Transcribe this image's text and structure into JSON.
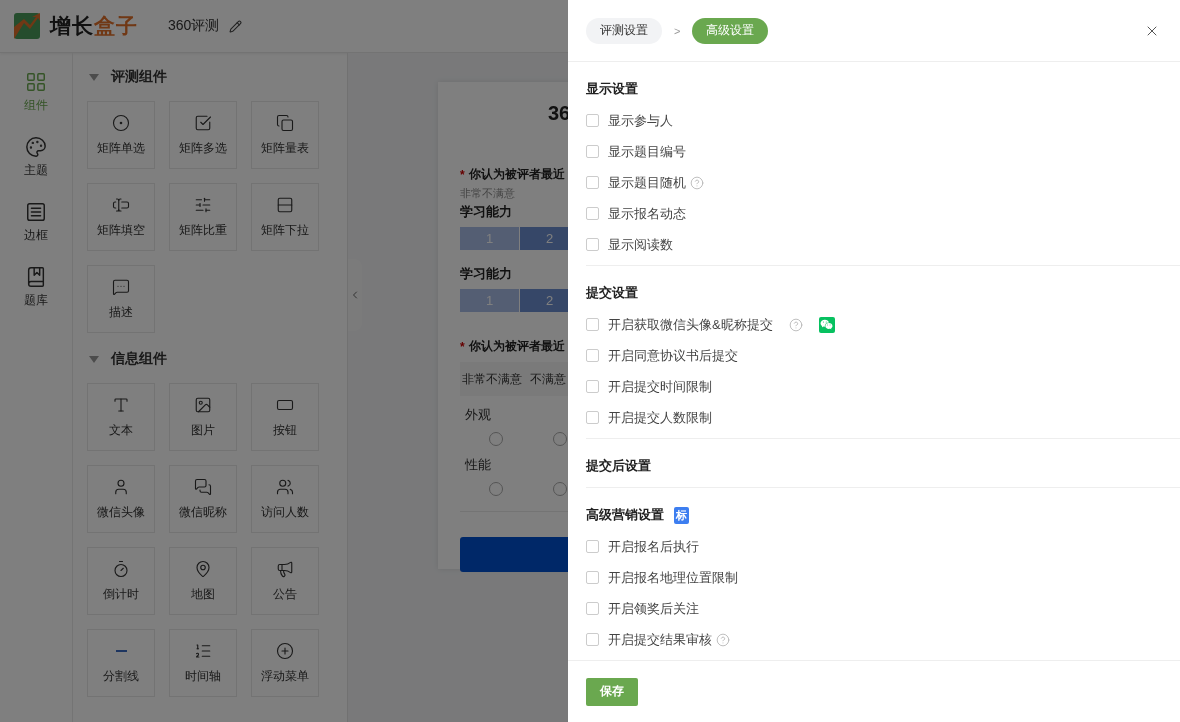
{
  "header": {
    "logo_dark": "增长",
    "logo_accent": "盒子",
    "project_title": "360评测"
  },
  "rail": [
    {
      "label": "组件",
      "selected": true
    },
    {
      "label": "主题",
      "selected": false
    },
    {
      "label": "边框",
      "selected": false
    },
    {
      "label": "题库",
      "selected": false
    }
  ],
  "widget_groups": [
    {
      "title": "评测组件",
      "expanded": true,
      "items": [
        {
          "label": "矩阵单选"
        },
        {
          "label": "矩阵多选"
        },
        {
          "label": "矩阵量表"
        },
        {
          "label": "矩阵填空"
        },
        {
          "label": "矩阵比重"
        },
        {
          "label": "矩阵下拉"
        },
        {
          "label": "描述"
        }
      ]
    },
    {
      "title": "信息组件",
      "expanded": true,
      "items": [
        {
          "label": "文本"
        },
        {
          "label": "图片"
        },
        {
          "label": "按钮"
        },
        {
          "label": "微信头像"
        },
        {
          "label": "微信昵称"
        },
        {
          "label": "访问人数"
        },
        {
          "label": "倒计时"
        },
        {
          "label": "地图"
        },
        {
          "label": "公告"
        },
        {
          "label": "分割线"
        },
        {
          "label": "时间轴"
        },
        {
          "label": "浮动菜单"
        }
      ]
    }
  ],
  "preview": {
    "title": "36",
    "question_1": {
      "required_mark": "*",
      "title": "你认为被评者最近",
      "scale_hint": "非常不满意",
      "rows": [
        {
          "label": "学习能力",
          "cells": [
            "1",
            "2"
          ]
        },
        {
          "label": "学习能力",
          "cells": [
            "1",
            "2"
          ]
        }
      ]
    },
    "question_2": {
      "required_mark": "*",
      "title": "你认为被评者最近",
      "columns": [
        "非常不满意",
        "不满意"
      ],
      "rows": [
        {
          "label": "外观",
          "radios": [
            false,
            false
          ]
        },
        {
          "label": "性能",
          "radios": [
            false,
            false
          ]
        }
      ]
    }
  },
  "drawer": {
    "breadcrumb": [
      {
        "label": "评测设置",
        "selected": false
      },
      {
        "label": "高级设置",
        "selected": true
      }
    ],
    "separator": ">",
    "sections": [
      {
        "title": "显示设置",
        "options": [
          {
            "label": "显示参与人",
            "checked": false
          },
          {
            "label": "显示题目编号",
            "checked": false
          },
          {
            "label": "显示题目随机",
            "checked": false,
            "help": true
          },
          {
            "label": "显示报名动态",
            "checked": false
          },
          {
            "label": "显示阅读数",
            "checked": false
          }
        ]
      },
      {
        "title": "提交设置",
        "options": [
          {
            "label": "开启获取微信头像&昵称提交",
            "checked": false,
            "help": true,
            "wechat": true
          },
          {
            "label": "开启同意协议书后提交",
            "checked": false
          },
          {
            "label": "开启提交时间限制",
            "checked": false
          },
          {
            "label": "开启提交人数限制",
            "checked": false
          }
        ]
      },
      {
        "title": "提交后设置"
      },
      {
        "title": "高级营销设置",
        "badge": "标",
        "options": [
          {
            "label": "开启报名后执行",
            "checked": false
          },
          {
            "label": "开启报名地理位置限制",
            "checked": false
          },
          {
            "label": "开启领奖后关注",
            "checked": false
          },
          {
            "label": "开启提交结果审核",
            "checked": false,
            "help": true
          }
        ]
      }
    ],
    "save": "保存"
  }
}
